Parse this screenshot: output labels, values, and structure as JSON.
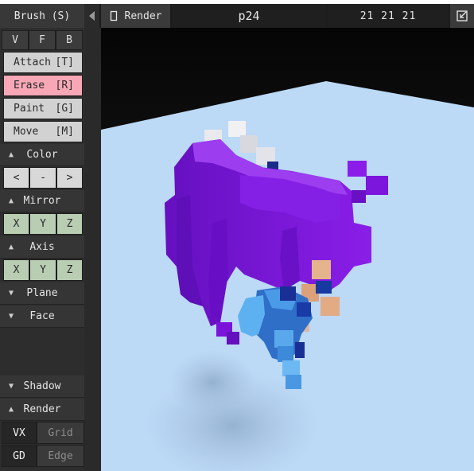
{
  "topbar": {
    "brush_label": "Brush (S)",
    "render_label": "Render",
    "file_name": "p24",
    "size": "21 21 21"
  },
  "mode_buttons": [
    "V",
    "F",
    "B"
  ],
  "tools": {
    "attach": {
      "name": "Attach",
      "key": "[T]"
    },
    "erase": {
      "name": "Erase",
      "key": "[R]"
    },
    "paint": {
      "name": "Paint",
      "key": "[G]"
    },
    "move": {
      "name": "Move",
      "key": "[M]"
    }
  },
  "sections": {
    "color": "Color",
    "mirror": "Mirror",
    "axis": "Axis",
    "plane": "Plane",
    "face": "Face",
    "shadow": "Shadow",
    "render": "Render"
  },
  "color_nav": [
    "<",
    "-",
    ">"
  ],
  "mirror_axes": [
    "X",
    "Y",
    "Z"
  ],
  "axis_axes": [
    "X",
    "Y",
    "Z"
  ],
  "render_options": {
    "vx": "VX",
    "grid": "Grid",
    "gd": "GD",
    "edge": "Edge"
  },
  "colors": {
    "active_tool": "#f7a7b6",
    "axis_button": "#b9cdb3",
    "floor": "#bcd9f6",
    "voxel_purple": "#7a12d8",
    "voxel_blue": "#3f8fe0"
  }
}
